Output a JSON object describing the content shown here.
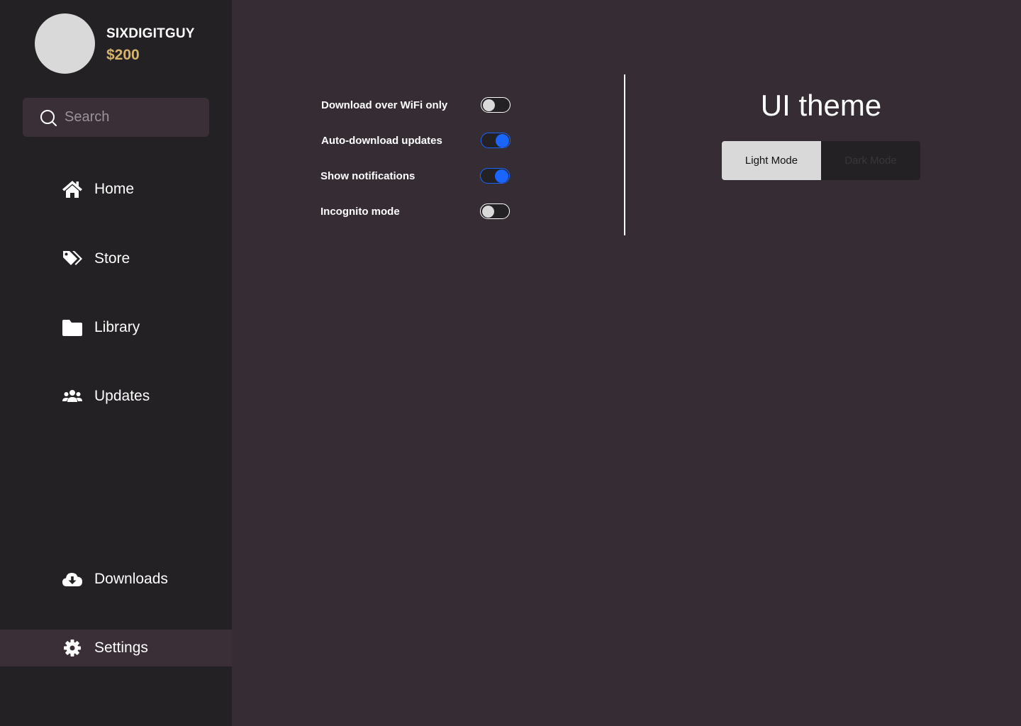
{
  "user": {
    "name": "SIXDIGITGUY",
    "balance": "$200"
  },
  "search": {
    "placeholder": "Search",
    "value": ""
  },
  "nav": {
    "items": [
      {
        "label": "Home",
        "icon": "home-icon"
      },
      {
        "label": "Store",
        "icon": "tags-icon"
      },
      {
        "label": "Library",
        "icon": "folder-icon"
      },
      {
        "label": "Updates",
        "icon": "users-icon"
      }
    ],
    "downloads": {
      "label": "Downloads",
      "icon": "cloud-download-icon"
    },
    "settings": {
      "label": "Settings",
      "icon": "gear-icon",
      "active": true
    }
  },
  "settings": {
    "toggles": [
      {
        "label": "Download over WiFi only",
        "on": false
      },
      {
        "label": "Auto-download updates",
        "on": true
      },
      {
        "label": "Show notifications",
        "on": true
      },
      {
        "label": "Incognito mode",
        "on": false
      }
    ]
  },
  "theme": {
    "title": "UI theme",
    "light_label": "Light Mode",
    "dark_label": "Dark Mode",
    "selected": "light"
  },
  "colors": {
    "sidebar": "#232123",
    "main": "#362d34",
    "accent": "#1a64ff",
    "balance": "#d6b56b"
  }
}
